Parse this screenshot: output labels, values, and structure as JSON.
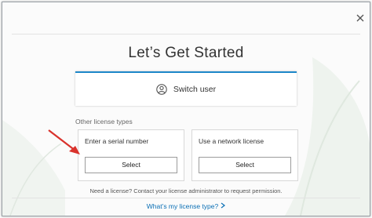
{
  "header": {
    "title": "Let’s Get Started",
    "close_icon": "close-icon"
  },
  "switch_user": {
    "label": "Switch user",
    "icon": "user-icon",
    "accent_color": "#1e88c9"
  },
  "other_license": {
    "section_label": "Other license types",
    "options": [
      {
        "label": "Enter a serial number",
        "button_label": "Select"
      },
      {
        "label": "Use a network license",
        "button_label": "Select"
      }
    ]
  },
  "footer": {
    "note": "Need a license? Contact your license administrator to request permission.",
    "link_text": "What’s my license type?",
    "link_color": "#0a6fb5"
  },
  "annotation": {
    "arrow_color": "#d9322c"
  }
}
